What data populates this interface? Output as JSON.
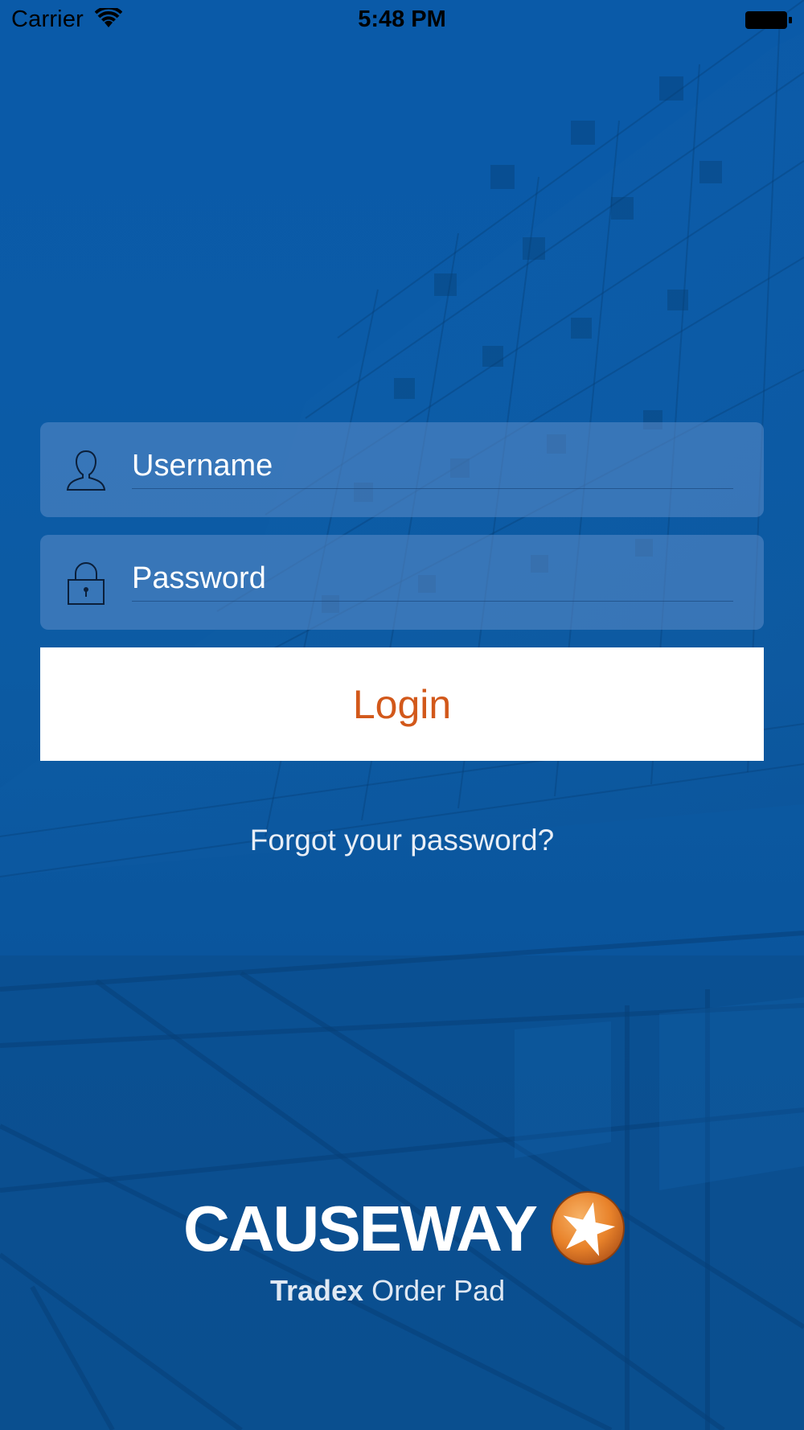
{
  "status_bar": {
    "carrier": "Carrier",
    "time": "5:48 PM"
  },
  "login_form": {
    "username_placeholder": "Username",
    "password_placeholder": "Password",
    "login_label": "Login",
    "forgot_label": "Forgot your password?"
  },
  "branding": {
    "logo_text": "CAUSEWAY",
    "product_bold": "Tradex",
    "product_rest": "Order Pad"
  },
  "colors": {
    "background": "#0a5aa6",
    "field_background": "#5c8cc8",
    "button_background": "#ffffff",
    "button_text": "#d2581a",
    "logo_accent": "#e8822a"
  },
  "icons": {
    "status": [
      "wifi-icon",
      "battery-icon"
    ],
    "username_field": "user-icon",
    "password_field": "lock-icon",
    "logo": "star-icon"
  }
}
